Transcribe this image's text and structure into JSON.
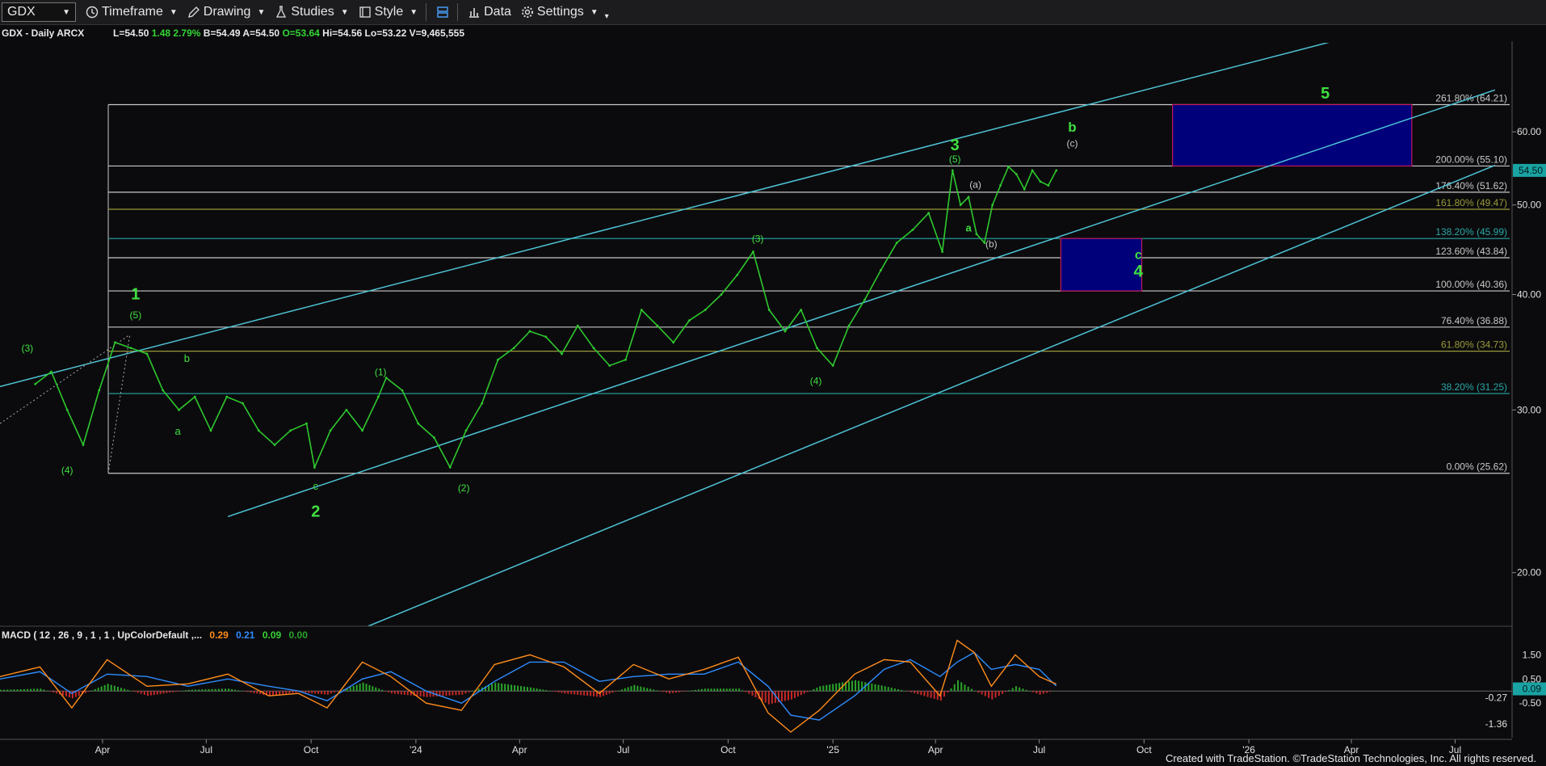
{
  "toolbar": {
    "symbol": "GDX",
    "items": [
      {
        "label": "Timeframe",
        "icon": "clock-icon"
      },
      {
        "label": "Drawing",
        "icon": "pencil-icon"
      },
      {
        "label": "Studies",
        "icon": "flask-icon"
      },
      {
        "label": "Style",
        "icon": "style-icon"
      },
      {
        "label": "",
        "icon": "layout-icon"
      },
      {
        "label": "Data",
        "icon": "bars-icon"
      },
      {
        "label": "Settings",
        "icon": "gear-icon"
      }
    ]
  },
  "quote": {
    "title": "GDX - Daily",
    "exchange": "ARCX",
    "last": "L=54.50",
    "change": "1.48",
    "pct": "2.79%",
    "bid": "B=54.49",
    "ask": "A=54.50",
    "open": "O=53.64",
    "high": "Hi=54.56",
    "low": "Lo=53.22",
    "volume": "V=9,465,555"
  },
  "macd_header": {
    "label": "MACD ( 12 , 26 , 9 , 1 , 1 , UpColorDefault ,...",
    "values": [
      {
        "text": "0.29",
        "color": "#ff8c1a"
      },
      {
        "text": "0.21",
        "color": "#2f8cff"
      },
      {
        "text": "0.09",
        "color": "#37d337"
      },
      {
        "text": "0.00",
        "color": "#2aa52a"
      }
    ]
  },
  "colors": {
    "price": "#2ec92e",
    "channel": "#4ec3d6",
    "fib_white": "#c8c8c8",
    "fib_olive": "#9a9a3a",
    "fib_teal": "#2aa6a6",
    "box": "#00007a",
    "box_border": "#c2185b",
    "wave_label": "#3fe03f",
    "macd_line": "#ff8c1a",
    "signal_line": "#2f8cff",
    "hist_up": "#2aa52a",
    "hist_down": "#c62828",
    "last_price_tag": "#1aa3a3"
  },
  "chart_data": [
    {
      "type": "line",
      "series": [
        {
          "name": "GDX",
          "x": [
            "2023-02-01",
            "2023-02-15",
            "2023-03-01",
            "2023-03-15",
            "2023-03-29",
            "2023-04-12",
            "2023-04-26",
            "2023-05-10",
            "2023-05-24",
            "2023-06-07",
            "2023-06-21",
            "2023-07-05",
            "2023-07-19",
            "2023-08-02",
            "2023-08-16",
            "2023-08-30",
            "2023-09-13",
            "2023-09-27",
            "2023-10-04",
            "2023-10-18",
            "2023-11-01",
            "2023-11-15",
            "2023-11-29",
            "2023-12-06",
            "2023-12-20",
            "2024-01-03",
            "2024-01-17",
            "2024-01-31",
            "2024-02-14",
            "2024-02-28",
            "2024-03-13",
            "2024-03-27",
            "2024-04-10",
            "2024-04-24",
            "2024-05-08",
            "2024-05-22",
            "2024-06-05",
            "2024-06-19",
            "2024-07-03",
            "2024-07-17",
            "2024-07-31",
            "2024-08-14",
            "2024-08-28",
            "2024-09-11",
            "2024-09-25",
            "2024-10-09",
            "2024-10-23",
            "2024-11-06",
            "2024-11-20",
            "2024-12-04",
            "2024-12-18",
            "2025-01-01",
            "2025-01-15",
            "2025-01-29",
            "2025-02-12",
            "2025-02-26",
            "2025-03-12",
            "2025-03-26",
            "2025-04-07",
            "2025-04-16",
            "2025-04-23",
            "2025-04-30",
            "2025-05-07",
            "2025-05-14",
            "2025-05-21",
            "2025-05-28",
            "2025-06-04",
            "2025-06-11",
            "2025-06-18",
            "2025-06-25",
            "2025-07-02",
            "2025-07-09",
            "2025-07-16"
          ],
          "values": [
            32.0,
            33.0,
            30.0,
            27.5,
            31.5,
            35.5,
            35.0,
            34.5,
            31.5,
            30.0,
            31.0,
            28.5,
            31.0,
            30.5,
            28.5,
            27.5,
            28.5,
            29.0,
            26.0,
            28.5,
            30.0,
            28.5,
            31.0,
            32.5,
            31.5,
            29.0,
            28.0,
            26.0,
            28.5,
            30.5,
            34.0,
            35.0,
            36.5,
            36.0,
            34.5,
            37.0,
            35.0,
            33.5,
            34.0,
            38.5,
            37.0,
            35.5,
            37.5,
            38.5,
            40.0,
            42.0,
            44.5,
            38.5,
            36.5,
            38.5,
            35.0,
            33.5,
            37.0,
            39.5,
            42.5,
            45.5,
            47.0,
            49.0,
            44.5,
            54.5,
            50.0,
            51.0,
            46.5,
            45.5,
            50.0,
            52.5,
            55.0,
            54.0,
            52.0,
            54.5,
            53.0,
            52.5,
            54.5
          ]
        }
      ],
      "ylim": [
        17.5,
        74
      ],
      "y_scale": "log",
      "yticks": [
        20,
        30,
        40,
        50,
        60
      ],
      "xticks": [
        {
          "label": "Apr",
          "x": "2023-04-01"
        },
        {
          "label": "Jul",
          "x": "2023-07-01"
        },
        {
          "label": "Oct",
          "x": "2023-10-01"
        },
        {
          "label": "'24",
          "x": "2024-01-01"
        },
        {
          "label": "Apr",
          "x": "2024-04-01"
        },
        {
          "label": "Jul",
          "x": "2024-07-01"
        },
        {
          "label": "Oct",
          "x": "2024-10-01"
        },
        {
          "label": "'25",
          "x": "2025-01-01"
        },
        {
          "label": "Apr",
          "x": "2025-04-01"
        },
        {
          "label": "Jul",
          "x": "2025-07-01"
        },
        {
          "label": "Oct",
          "x": "2025-10-01"
        },
        {
          "label": "'26",
          "x": "2026-01-01"
        },
        {
          "label": "Apr",
          "x": "2026-04-01"
        },
        {
          "label": "Jul",
          "x": "2026-07-01"
        }
      ],
      "last_price": {
        "value": 54.5,
        "label": "54.50"
      },
      "fib_levels": [
        {
          "label": "261.80% (64.21)",
          "value": 64.21,
          "color": "fib_white"
        },
        {
          "label": "200.00% (55.10)",
          "value": 55.1,
          "color": "fib_white"
        },
        {
          "label": "176.40% (51.62)",
          "value": 51.62,
          "color": "fib_white"
        },
        {
          "label": "161.80% (49.47)",
          "value": 49.47,
          "color": "fib_olive"
        },
        {
          "label": "138.20% (45.99)",
          "value": 45.99,
          "color": "fib_teal"
        },
        {
          "label": "123.60% (43.84)",
          "value": 43.84,
          "color": "fib_white"
        },
        {
          "label": "100.00% (40.36)",
          "value": 40.36,
          "color": "fib_white"
        },
        {
          "label": "76.40% (36.88)",
          "value": 36.88,
          "color": "fib_white"
        },
        {
          "label": "61.80% (34.73)",
          "value": 34.73,
          "color": "fib_olive"
        },
        {
          "label": "38.20% (31.25)",
          "value": 31.25,
          "color": "fib_teal"
        },
        {
          "label": "0.00% (25.62)",
          "value": 25.62,
          "color": "fib_white"
        }
      ],
      "fib_anchor_x": "2023-04-06",
      "channels": [
        {
          "from": {
            "x": "2023-01-01",
            "y": 31.8
          },
          "to": {
            "x": "2026-05-22",
            "y": 79.0
          }
        },
        {
          "from": {
            "x": "2023-07-20",
            "y": 23.0
          },
          "to": {
            "x": "2026-08-05",
            "y": 66.6
          }
        },
        {
          "from": {
            "x": "2023-11-20",
            "y": 17.5
          },
          "to": {
            "x": "2026-08-05",
            "y": 55.2
          }
        }
      ],
      "dotted_lines": [
        {
          "from": {
            "x": "2023-01-01",
            "y": 29.0
          },
          "to": {
            "x": "2023-04-25",
            "y": 36.2
          }
        },
        {
          "from": {
            "x": "2023-04-06",
            "y": 25.62
          },
          "to": {
            "x": "2023-04-25",
            "y": 36.2
          }
        }
      ],
      "target_boxes": [
        {
          "x0": "2025-10-26",
          "x1": "2026-05-24",
          "y0": 55.1,
          "y1": 64.21
        },
        {
          "x0": "2025-07-20",
          "x1": "2025-09-29",
          "y0": 40.36,
          "y1": 45.99
        }
      ],
      "annotations": [
        {
          "text": "(3)",
          "x": "2023-01-25",
          "y": 34.7,
          "size": 12,
          "color": "wave_label"
        },
        {
          "text": "(4)",
          "x": "2023-03-01",
          "y": 25.6,
          "size": 12,
          "color": "wave_label"
        },
        {
          "text": "1",
          "x": "2023-04-30",
          "y": 39.5,
          "size": 20,
          "color": "wave_label",
          "bold": true
        },
        {
          "text": "(5)",
          "x": "2023-04-30",
          "y": 37.7,
          "size": 12,
          "color": "wave_label"
        },
        {
          "text": "b",
          "x": "2023-06-14",
          "y": 33.8,
          "size": 13,
          "color": "wave_label"
        },
        {
          "text": "a",
          "x": "2023-06-06",
          "y": 28.2,
          "size": 13,
          "color": "wave_label"
        },
        {
          "text": "c",
          "x": "2023-10-05",
          "y": 24.6,
          "size": 13,
          "color": "wave_label"
        },
        {
          "text": "2",
          "x": "2023-10-05",
          "y": 23.0,
          "size": 20,
          "color": "wave_label",
          "bold": true
        },
        {
          "text": "(1)",
          "x": "2023-12-01",
          "y": 32.7,
          "size": 12,
          "color": "wave_label"
        },
        {
          "text": "(2)",
          "x": "2024-02-12",
          "y": 24.5,
          "size": 12,
          "color": "wave_label"
        },
        {
          "text": "(3)",
          "x": "2024-10-27",
          "y": 45.6,
          "size": 12,
          "color": "wave_label"
        },
        {
          "text": "(4)",
          "x": "2024-12-17",
          "y": 32.0,
          "size": 12,
          "color": "wave_label"
        },
        {
          "text": "3",
          "x": "2025-04-18",
          "y": 57.3,
          "size": 20,
          "color": "wave_label",
          "bold": true
        },
        {
          "text": "(5)",
          "x": "2025-04-18",
          "y": 55.6,
          "size": 12,
          "color": "wave_label"
        },
        {
          "text": "(a)",
          "x": "2025-05-06",
          "y": 52.2,
          "size": 12,
          "color": "fib_white"
        },
        {
          "text": "a",
          "x": "2025-04-30",
          "y": 46.8,
          "size": 13,
          "color": "wave_label",
          "bold": true
        },
        {
          "text": "(b)",
          "x": "2025-05-20",
          "y": 45.0,
          "size": 12,
          "color": "fib_white"
        },
        {
          "text": "b",
          "x": "2025-07-30",
          "y": 60.0,
          "size": 17,
          "color": "wave_label",
          "bold": true
        },
        {
          "text": "(c)",
          "x": "2025-07-30",
          "y": 57.8,
          "size": 12,
          "color": "fib_white"
        },
        {
          "text": "c",
          "x": "2025-09-26",
          "y": 43.7,
          "size": 16,
          "color": "wave_label",
          "bold": true
        },
        {
          "text": "4",
          "x": "2025-09-26",
          "y": 41.8,
          "size": 21,
          "color": "wave_label",
          "bold": true
        },
        {
          "text": "5",
          "x": "2026-03-09",
          "y": 65.2,
          "size": 20,
          "color": "wave_label",
          "bold": true
        }
      ]
    },
    {
      "type": "line",
      "name": "MACD",
      "x": [
        "2023-01-01",
        "2023-02-05",
        "2023-03-05",
        "2023-04-05",
        "2023-05-10",
        "2023-06-15",
        "2023-07-20",
        "2023-08-25",
        "2023-09-20",
        "2023-10-15",
        "2023-11-15",
        "2023-12-10",
        "2024-01-10",
        "2024-02-10",
        "2024-03-10",
        "2024-04-10",
        "2024-05-10",
        "2024-06-10",
        "2024-07-10",
        "2024-08-10",
        "2024-09-10",
        "2024-10-10",
        "2024-11-05",
        "2024-11-25",
        "2024-12-20",
        "2025-01-20",
        "2025-02-15",
        "2025-03-10",
        "2025-04-05",
        "2025-04-20",
        "2025-05-05",
        "2025-05-20",
        "2025-06-10",
        "2025-07-01",
        "2025-07-16"
      ],
      "series": [
        {
          "name": "MACD",
          "values": [
            0.6,
            1.0,
            -0.7,
            1.3,
            0.2,
            0.3,
            0.7,
            -0.2,
            -0.1,
            -0.7,
            1.2,
            0.6,
            -0.5,
            -0.8,
            1.1,
            1.5,
            1.0,
            -0.1,
            1.1,
            0.5,
            0.9,
            1.4,
            -0.9,
            -1.7,
            -0.8,
            0.7,
            1.3,
            1.2,
            -0.2,
            2.1,
            1.6,
            0.2,
            1.5,
            0.6,
            0.29
          ]
        },
        {
          "name": "Signal",
          "values": [
            0.5,
            0.8,
            -0.1,
            0.7,
            0.6,
            0.2,
            0.5,
            0.2,
            0.0,
            -0.4,
            0.5,
            0.8,
            0.0,
            -0.5,
            0.4,
            1.2,
            1.2,
            0.4,
            0.6,
            0.7,
            0.7,
            1.2,
            0.2,
            -1.0,
            -1.2,
            -0.2,
            0.9,
            1.3,
            0.6,
            1.2,
            1.6,
            0.9,
            1.1,
            0.9,
            0.21
          ]
        }
      ],
      "ylim": [
        -1.6,
        1.95
      ],
      "yticks": [
        1.5,
        0.5,
        -0.5
      ],
      "ytick_labels": [
        "1.50",
        "0.50",
        "-0.50"
      ],
      "value_tags": [
        {
          "label": "-1.36",
          "value": -1.36
        },
        {
          "label": "-0.27",
          "value": -0.27
        },
        {
          "label": "0.09",
          "value": 0.09
        }
      ]
    }
  ],
  "footer": "Created with TradeStation. ©TradeStation Technologies, Inc. All rights reserved."
}
